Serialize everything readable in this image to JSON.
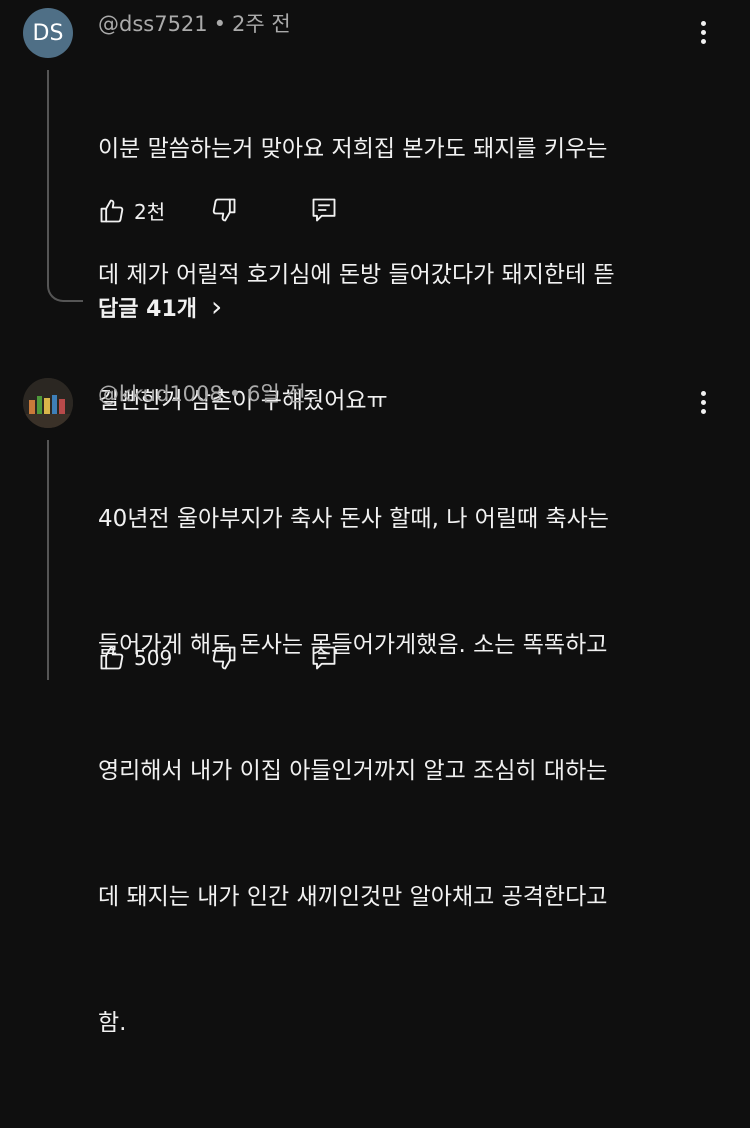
{
  "comments": [
    {
      "avatar_initials": "DS",
      "username": "@dss7521",
      "dot": "•",
      "time": "2주 전",
      "lines": [
        "이분 말씀하는거 맞아요 저희집 본가도 돼지를 키우는",
        "데 제가 어릴적 호기심에 돈방 들어갔다가 돼지한테 뜯",
        "길뻔한거 삼촌이 구해줬어요ㅠ"
      ],
      "likes": "2천",
      "replies_label": "답글 41개",
      "replies_chevron": "›"
    },
    {
      "avatar_initials": "",
      "username": "@kkud1008",
      "dot": "•",
      "time": "6일 전",
      "lines": [
        "40년전 울아부지가 축사 돈사 할때, 나 어릴때 축사는",
        "들어가게 해도 돈사는 못들어가게했음. 소는 똑똑하고",
        "영리해서 내가 이집 아들인거까지 알고 조심히 대하는",
        "데 돼지는 내가 인간 새끼인것만 알아채고 공격한다고",
        "함."
      ],
      "likes": "509"
    }
  ],
  "icons": {
    "like": "thumbs-up-icon",
    "dislike": "thumbs-down-icon",
    "reply": "reply-comment-icon",
    "more": "more-vertical-icon"
  },
  "colors": {
    "background": "#0f0f0f",
    "text": "#f1f1f1",
    "meta": "#aaaaaa",
    "avatar_ds": "#4f6f86"
  }
}
